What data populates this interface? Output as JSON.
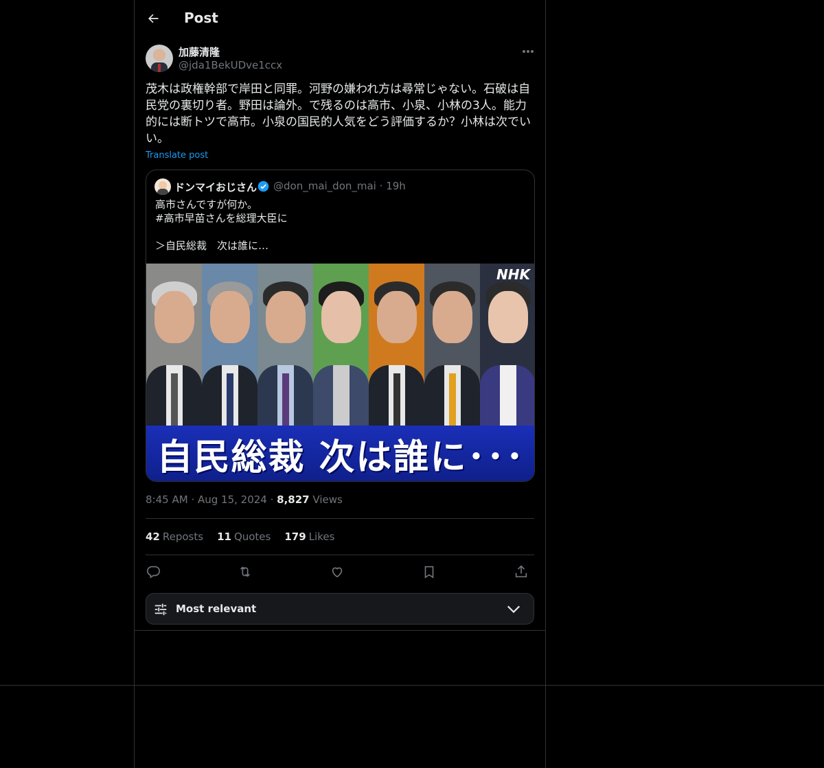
{
  "header": {
    "title": "Post"
  },
  "post": {
    "author_name": "加藤清隆",
    "author_handle": "@jda1BekUDve1ccx",
    "text": "茂木は政権幹部で岸田と同罪。河野の嫌われ方は尋常じゃない。石破は自民党の裏切り者。野田は論外。で残るのは高市、小泉、小林の3人。能力的には断トツで高市。小泉の国民的人気をどう評価するか？小林は次でいい。",
    "translate_label": "Translate post",
    "time": "8:45 AM",
    "date": "Aug 15, 2024",
    "views_count": "8,827",
    "views_label": "Views"
  },
  "quote": {
    "name": "ドンマイおじさん",
    "handle": "@don_mai_don_mai",
    "age": "19h",
    "text": "高市さんですが何か。\n#高市早苗さんを総理大臣に\n\n＞自民総裁　次は誰に…",
    "image_banner": "自民総裁 次は誰に･･･",
    "image_logo": "NHK"
  },
  "stats": {
    "reposts_count": "42",
    "reposts_label": "Reposts",
    "quotes_count": "11",
    "quotes_label": "Quotes",
    "likes_count": "179",
    "likes_label": "Likes"
  },
  "sort": {
    "label": "Most relevant"
  },
  "colors": {
    "background": "#000000",
    "border": "#2f3336",
    "accent": "#1d9bf0",
    "muted": "#71767b",
    "text": "#e7e9ea"
  },
  "icons": [
    "back-arrow-icon",
    "more-icon",
    "verified-icon",
    "reply-icon",
    "repost-icon",
    "like-icon",
    "bookmark-icon",
    "share-icon",
    "sliders-icon",
    "chevron-down-icon"
  ]
}
